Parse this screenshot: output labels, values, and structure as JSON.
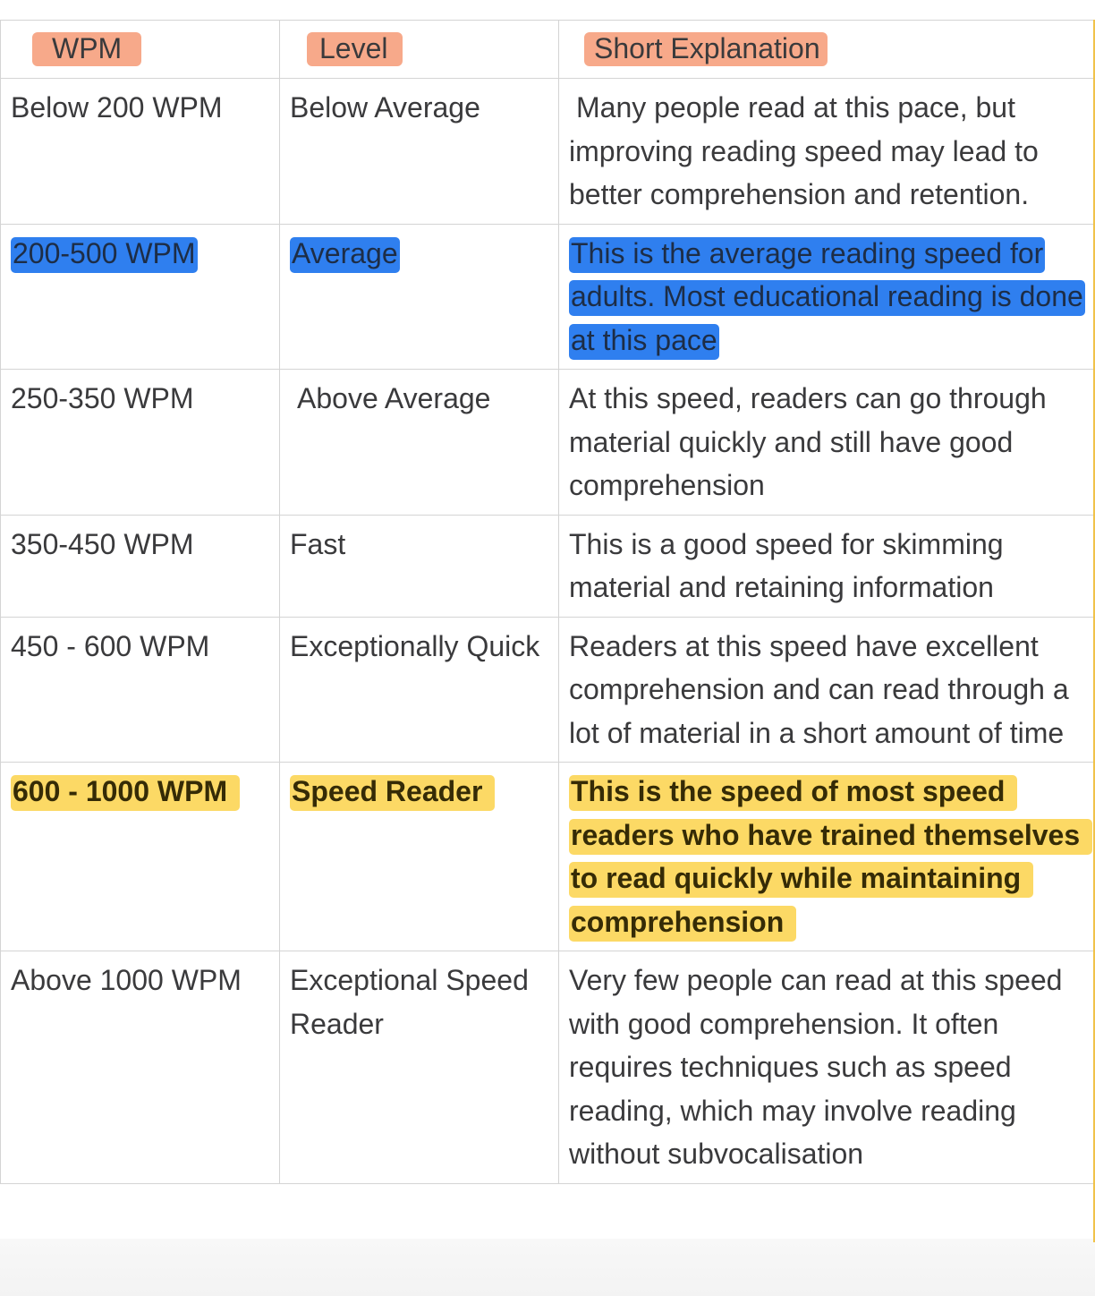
{
  "table": {
    "headers": [
      "WPM",
      "Level",
      "Short Explanation"
    ],
    "rows": [
      {
        "wpm": "Below 200 WPM",
        "level": "Below Average",
        "explanation": "Many people read at this pace, but improving reading speed may lead to better comprehension and retention.",
        "highlight": "none"
      },
      {
        "wpm": "200-500 WPM",
        "level": "Average",
        "explanation": "This is the average reading speed for adults. Most educational reading is done at this pace",
        "highlight": "blue"
      },
      {
        "wpm": "250-350 WPM",
        "level": "Above Average",
        "explanation": "At this speed, readers can go through material quickly and still have good comprehension",
        "highlight": "none"
      },
      {
        "wpm": "350-450 WPM",
        "level": "Fast",
        "explanation": "This is a good speed for skimming material and retaining information",
        "highlight": "none"
      },
      {
        "wpm": "450 - 600 WPM",
        "level": "Exceptionally Quick",
        "explanation": "Readers at this speed have excellent comprehension and can read through a lot of material in a short amount of time",
        "highlight": "none"
      },
      {
        "wpm": "600 - 1000 WPM",
        "level": "Speed Reader",
        "explanation": "This is the speed of most speed readers who have trained themselves to read quickly while maintaining comprehension",
        "highlight": "yellow"
      },
      {
        "wpm": "Above 1000 WPM",
        "level": "Exceptional Speed Reader",
        "explanation": "Very few people can read at this speed with good comprehension. It often requires techniques such as speed reading, which may involve reading without subvocalisation",
        "highlight": "none"
      }
    ]
  },
  "colors": {
    "header_highlight": "#f7a98a",
    "blue_highlight": "#2f7fef",
    "yellow_highlight": "#fcd965",
    "text": "#3a3a3c",
    "grid": "#d4d4d4"
  }
}
